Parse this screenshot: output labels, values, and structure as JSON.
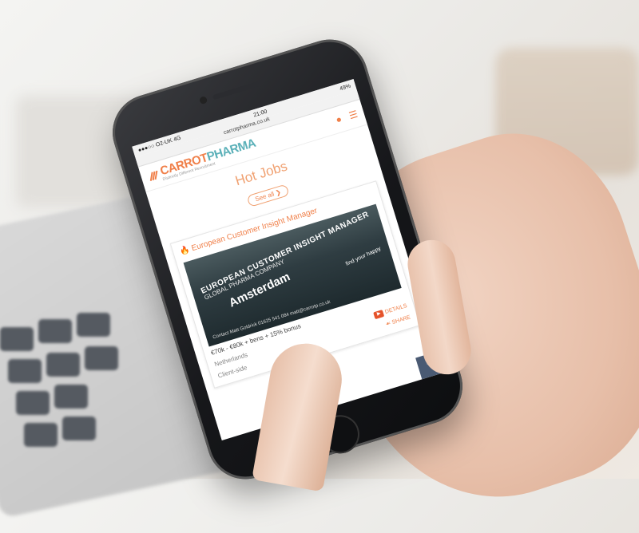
{
  "status_bar": {
    "carrier": "●●●○○ O2-UK 4G",
    "time": "21:00",
    "battery": "49%"
  },
  "url_bar": {
    "url": "carrotpharma.co.uk"
  },
  "header": {
    "logo_carrot": "CARROT",
    "logo_pharma": "PHARMA",
    "logo_tagline": "Distinctly Different Recruitment"
  },
  "hot_jobs": {
    "title": "Hot Jobs",
    "see_all_label": "See all"
  },
  "job_card": {
    "title": "European Customer Insight Manager",
    "banner": {
      "line1": "EUROPEAN CUSTOMER INSIGHT MANAGER",
      "line2": "GLOBAL PHARMA COMPANY",
      "line3": "Amsterdam",
      "line4": "find your happy",
      "line5": "Contact Matt Goldrick 01625 541 084 matt@carrotp.co.uk"
    },
    "salary": "€70k - €80k + bens + 15% bonus",
    "location": "Netherlands",
    "type": "Client-side",
    "details_label": "DETAILS",
    "share_label": "SHARE"
  },
  "colors": {
    "brand_orange": "#f0804a",
    "brand_teal": "#5ab0b8",
    "details_red": "#e5532b",
    "scroll_top_bg": "#4a5a73"
  }
}
